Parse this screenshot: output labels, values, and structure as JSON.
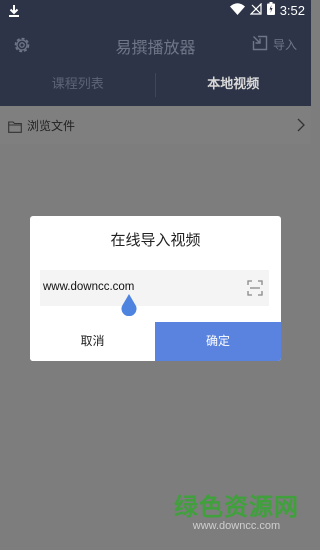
{
  "status_bar": {
    "time": "3:52"
  },
  "app_bar": {
    "title": "易撰播放器",
    "import_label": "导入"
  },
  "tabs": [
    {
      "label": "课程列表"
    },
    {
      "label": "本地视频"
    }
  ],
  "browse": {
    "label": "浏览文件"
  },
  "dialog": {
    "title": "在线导入视频",
    "url_value": "www.downcc.com",
    "cancel_label": "取消",
    "ok_label": "确定"
  },
  "watermark": {
    "main": "绿色资源网",
    "sub": "www.downcc.com"
  },
  "colors": {
    "header": "#2d3448",
    "overlay": "#7d7d7d",
    "accent": "#5a83e0",
    "watermark": "#3fa03c"
  }
}
